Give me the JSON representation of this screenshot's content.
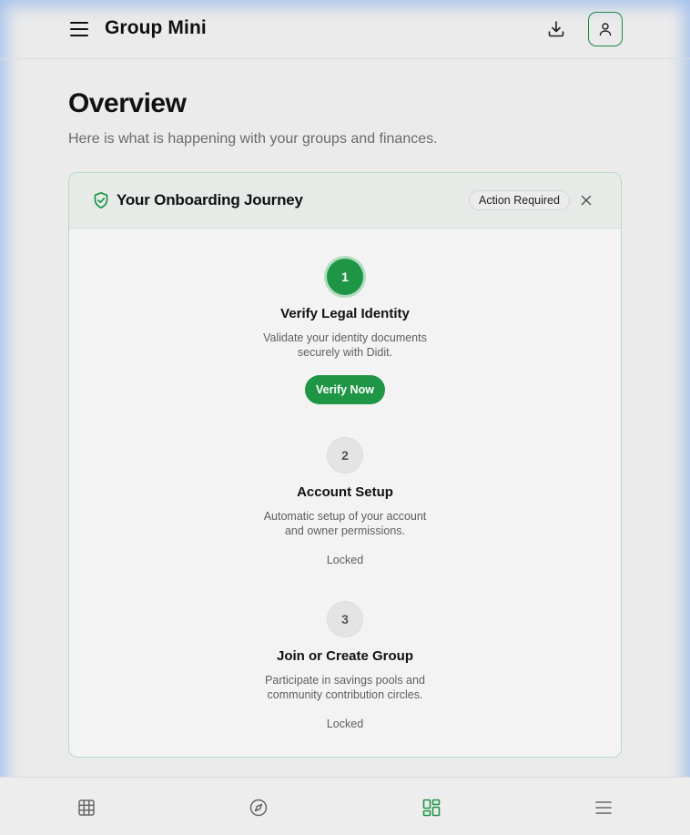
{
  "header": {
    "title": "Group Mini",
    "icons": [
      "menu-icon",
      "download-icon",
      "user-icon"
    ]
  },
  "page": {
    "title": "Overview",
    "subtitle": "Here is what is happening with your groups and finances."
  },
  "onboarding": {
    "title": "Your Onboarding Journey",
    "badge": "Action Required",
    "accent": "#1e9646",
    "steps": [
      {
        "number": "1",
        "title": "Verify Legal Identity",
        "description": "Validate your identity documents securely with Didit.",
        "action": "Verify Now",
        "state": "active"
      },
      {
        "number": "2",
        "title": "Account Setup",
        "description": "Automatic setup of your account and owner permissions.",
        "status": "Locked",
        "state": "locked"
      },
      {
        "number": "3",
        "title": "Join or Create Group",
        "description": "Participate in savings pools and community contribution circles.",
        "status": "Locked",
        "state": "locked"
      }
    ]
  },
  "bottom_nav": {
    "items": [
      {
        "icon": "grid-icon",
        "active": false
      },
      {
        "icon": "compass-icon",
        "active": false
      },
      {
        "icon": "dashboard-icon",
        "active": true
      },
      {
        "icon": "list-menu-icon",
        "active": false
      }
    ]
  }
}
